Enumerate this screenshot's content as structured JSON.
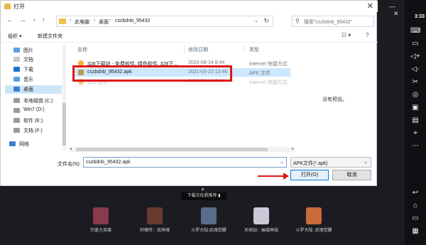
{
  "dialog": {
    "title": "打开",
    "close": "✕"
  },
  "nav": {
    "back": "←",
    "forward": "→",
    "recent": "⌄",
    "up": "↑",
    "breadcrumb": [
      "此电脑",
      "桌面",
      "cszbdnb_95432"
    ],
    "refresh": "↻",
    "search_placeholder": "搜索\"cszbdnb_95432\""
  },
  "toolbar": {
    "organize": "组织 ▾",
    "new_folder": "新建文件夹",
    "view": "☷ ▾",
    "help": "?"
  },
  "sidebar": {
    "items": [
      {
        "label": "图片",
        "color": "#5aa0e6"
      },
      {
        "label": "文档",
        "color": "#c9c9c9"
      },
      {
        "label": "下载",
        "color": "#1f6fd1"
      },
      {
        "label": "音乐",
        "color": "#5aa0e6"
      },
      {
        "label": "桌面",
        "color": "#3c7fd1",
        "selected": true
      },
      {
        "label": "本地磁盘 (C:)",
        "color": "#9a9a9a"
      },
      {
        "label": "Win7 (D:)",
        "color": "#9a9a9a"
      },
      {
        "label": "软件 (E:)",
        "color": "#9a9a9a"
      },
      {
        "label": "文档 (F:)",
        "color": "#9a9a9a"
      },
      {
        "label": "网络",
        "color": "#3c7fd1"
      }
    ]
  },
  "columns": {
    "name": "名称",
    "date": "修改日期",
    "type": "类型"
  },
  "files": [
    {
      "name": "328下载站 - 免费软件, 绿色软件, 328下...",
      "date": "2020-08-14 8:44",
      "type": "Internet 快捷方式",
      "faded": false
    },
    {
      "name": "cszbdnb_95432.apk",
      "date": "2021-03-22 13:46",
      "type": "APK 文件",
      "selected": true
    },
    {
      "name": "软件说明",
      "date": "2020-08-14 8:44",
      "type": "Internet 快捷方式",
      "faded": true
    }
  ],
  "preview_text": "没有预览。",
  "footer": {
    "filename_label": "文件名(N):",
    "filename_value": "cszbdnb_95432.apk",
    "filetype": "APK文件(*.apk)",
    "open": "打开(O)",
    "cancel": "取消"
  },
  "emulator": {
    "clock": "3:33",
    "download_pill": "下载次优质推荐 ▮",
    "games": [
      {
        "label": "宗盛大英雄",
        "color": "#8a3a4a"
      },
      {
        "label": "轩辕传：武神魂",
        "color": "#6b3b2f"
      },
      {
        "label": "斗罗大陆:武魂觉醒",
        "color": "#5b6b8a"
      },
      {
        "label": "天地劫：幽城再临",
        "color": "#c9c9d8"
      },
      {
        "label": "斗罗大陆: 武魂觉醒",
        "color": "#c86a3a"
      }
    ]
  }
}
